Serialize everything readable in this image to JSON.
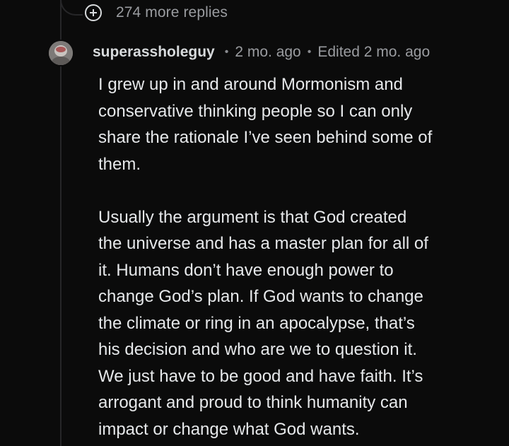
{
  "more_replies": {
    "label": "274 more replies",
    "icon": "plus-circle-icon"
  },
  "comment": {
    "username": "superassholeguy",
    "time": "2 mo. ago",
    "edited": "Edited 2 mo. ago",
    "separator": "•",
    "paragraphs": [
      {
        "lines": [
          "I grew up in and around Mormonism and",
          "conservative thinking people so I can only",
          "share the rationale I’ve seen behind some of",
          "them."
        ]
      },
      {
        "lines": [
          "Usually the argument is that God created",
          "the universe and has a master plan for all of",
          "it. Humans don’t have enough power to",
          "change God’s plan. If God wants to change",
          "the climate or ring in an apocalypse, that’s",
          "his decision and who are we to question it.",
          "We just have to be good and have faith. It’s",
          "arrogant and proud to think humanity can",
          "impact or change what God wants."
        ]
      }
    ]
  },
  "colors": {
    "background": "#0b0b0b",
    "text": "#e6e8ea",
    "muted": "#9a9ca0",
    "thread_line": "#262628"
  }
}
